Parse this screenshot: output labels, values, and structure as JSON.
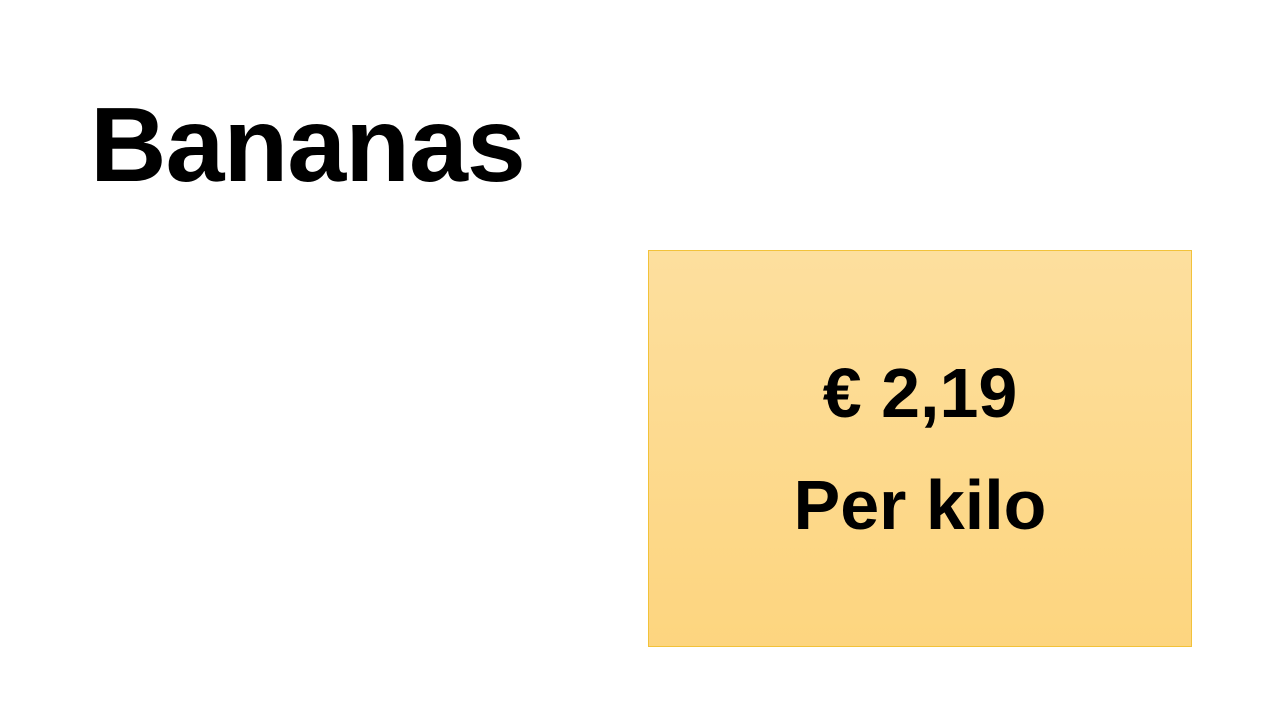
{
  "slide": {
    "title": "Bananas",
    "price_box": {
      "price": "€ 2,19",
      "unit": "Per kilo",
      "fill_top_color": "#fddf9e",
      "fill_bottom_color": "#fdd57f",
      "border_color": "#f2c23a"
    }
  }
}
